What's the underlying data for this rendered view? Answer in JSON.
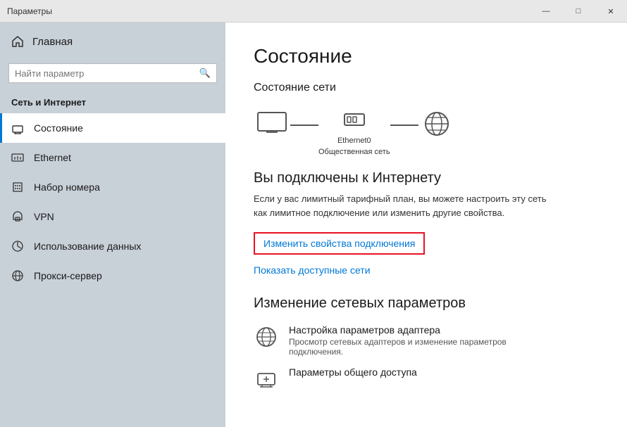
{
  "window": {
    "title": "Параметры",
    "min_btn": "—",
    "max_btn": "□",
    "close_btn": "✕"
  },
  "sidebar": {
    "title": "Параметры",
    "home_label": "Главная",
    "search_placeholder": "Найти параметр",
    "search_icon": "🔍",
    "section_label": "Сеть и Интернет",
    "items": [
      {
        "id": "status",
        "label": "Состояние",
        "active": true
      },
      {
        "id": "ethernet",
        "label": "Ethernet",
        "active": false
      },
      {
        "id": "dialup",
        "label": "Набор номера",
        "active": false
      },
      {
        "id": "vpn",
        "label": "VPN",
        "active": false
      },
      {
        "id": "data-usage",
        "label": "Использование данных",
        "active": false
      },
      {
        "id": "proxy",
        "label": "Прокси-сервер",
        "active": false
      }
    ]
  },
  "main": {
    "page_title": "Состояние",
    "network_status_title": "Состояние сети",
    "network_label": "Ethernet0",
    "network_sublabel": "Общественная сеть",
    "connected_title": "Вы подключены к Интернету",
    "connected_desc": "Если у вас лимитный тарифный план, вы можете настроить эту сеть как лимитное подключение или изменить другие свойства.",
    "change_btn_label": "Изменить свойства подключения",
    "show_networks_label": "Показать доступные сети",
    "change_section_title": "Изменение сетевых параметров",
    "settings": [
      {
        "id": "adapter",
        "title": "Настройка параметров адаптера",
        "desc": "Просмотр сетевых адаптеров и изменение параметров подключения."
      },
      {
        "id": "sharing",
        "title": "Параметры общего доступа",
        "desc": ""
      }
    ]
  }
}
